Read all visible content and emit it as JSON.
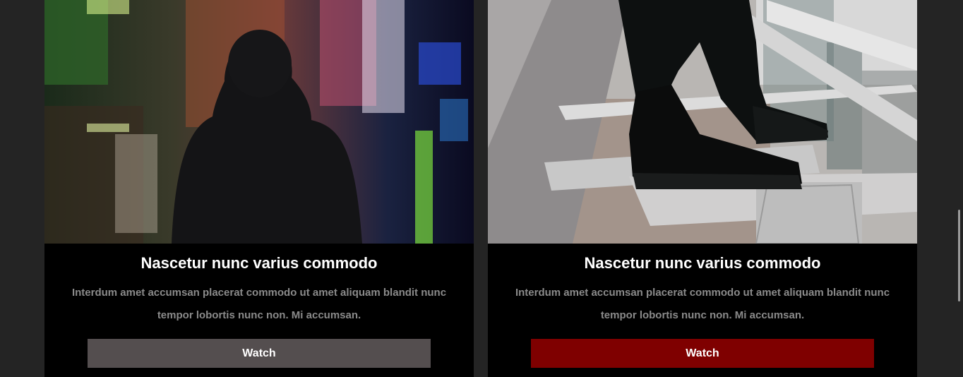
{
  "cards": [
    {
      "image": "person-in-hoodie-night-city-photo",
      "title": "Nascetur nunc varius commodo",
      "description": "Interdum amet accumsan placerat commodo ut amet aliquam blandit nunc tempor lobortis nunc non. Mi accumsan.",
      "button_label": "Watch",
      "button_color": "#544e4f"
    },
    {
      "image": "sneakers-on-metal-stairs-photo",
      "title": "Nascetur nunc varius commodo",
      "description": "Interdum amet accumsan placerat commodo ut amet aliquam blandit nunc tempor lobortis nunc non. Mi accumsan.",
      "button_label": "Watch",
      "button_color": "#7f0000"
    }
  ],
  "colors": {
    "page_background": "#242424",
    "card_background": "#000000",
    "description_text": "#8a8a8a"
  }
}
